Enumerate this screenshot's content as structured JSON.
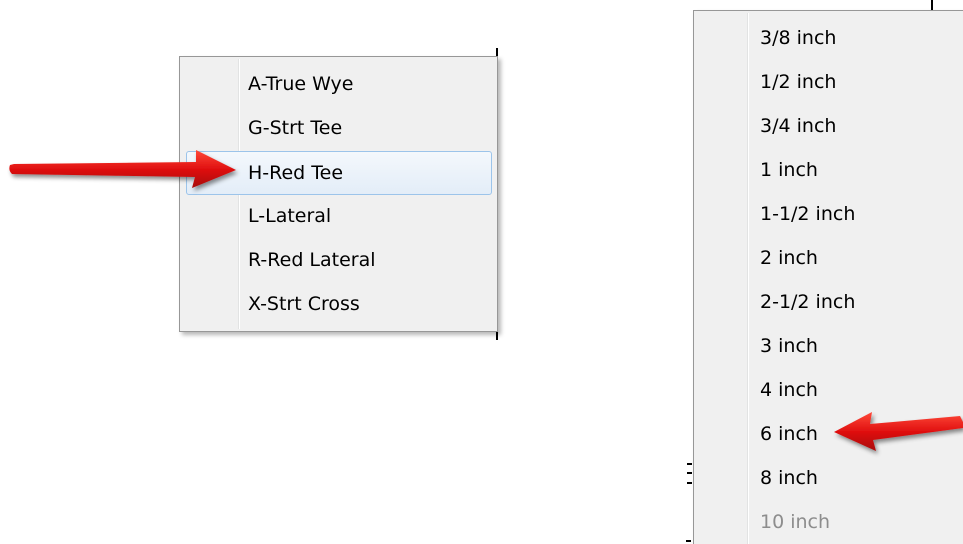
{
  "left_menu": {
    "items": [
      {
        "label": "A-True Wye",
        "highlighted": false,
        "disabled": false
      },
      {
        "label": "G-Strt Tee",
        "highlighted": false,
        "disabled": false
      },
      {
        "label": "H-Red Tee",
        "highlighted": true,
        "disabled": false
      },
      {
        "label": "L-Lateral",
        "highlighted": false,
        "disabled": false
      },
      {
        "label": "R-Red Lateral",
        "highlighted": false,
        "disabled": false
      },
      {
        "label": "X-Strt Cross",
        "highlighted": false,
        "disabled": false
      }
    ]
  },
  "right_menu": {
    "items": [
      {
        "label": "3/8 inch",
        "disabled": false
      },
      {
        "label": "1/2 inch",
        "disabled": false
      },
      {
        "label": "3/4 inch",
        "disabled": false
      },
      {
        "label": "1 inch",
        "disabled": false
      },
      {
        "label": "1-1/2 inch",
        "disabled": false
      },
      {
        "label": "2 inch",
        "disabled": false
      },
      {
        "label": "2-1/2 inch",
        "disabled": false
      },
      {
        "label": "3 inch",
        "disabled": false
      },
      {
        "label": "4 inch",
        "disabled": false
      },
      {
        "label": "6 inch",
        "disabled": false
      },
      {
        "label": "8 inch",
        "disabled": false
      },
      {
        "label": "10 inch",
        "disabled": true
      }
    ]
  },
  "annotations": {
    "arrow_color": "#e01010",
    "left_arrow_target": "H-Red Tee",
    "right_arrow_target": "6 inch"
  },
  "colors": {
    "menu_background": "#f0f0f0",
    "menu_border": "#979797",
    "highlight_border": "#9cc4ea",
    "disabled_text": "#8d8d8d"
  }
}
